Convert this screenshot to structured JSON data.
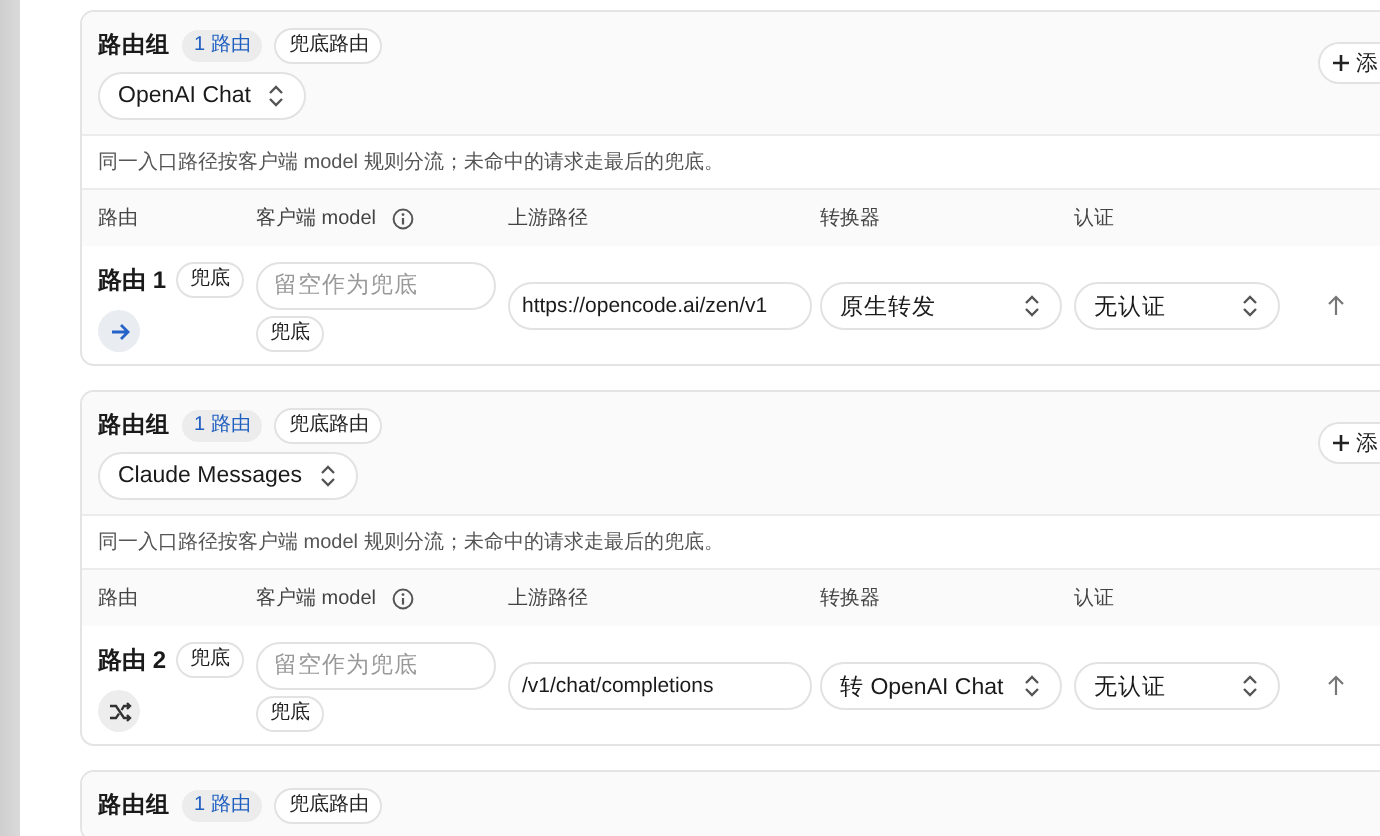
{
  "groups": [
    {
      "title": "路由组",
      "count_badge": "1 路由",
      "tag": "兜底路由",
      "protocol": "OpenAI Chat",
      "add_button": "添",
      "description": "同一入口路径按客户端 model 规则分流；未命中的请求走最后的兜底。",
      "columns": [
        "路由",
        "客户端 model",
        "上游路径",
        "转换器",
        "认证"
      ],
      "routes": [
        {
          "name": "路由 1",
          "tag": "兜底",
          "kind": "forward",
          "model_placeholder": "留空作为兜底",
          "model_tag": "兜底",
          "upstream": "https://opencode.ai/zen/v1",
          "converter": "原生转发",
          "auth": "无认证"
        }
      ]
    },
    {
      "title": "路由组",
      "count_badge": "1 路由",
      "tag": "兜底路由",
      "protocol": "Claude Messages",
      "add_button": "添",
      "description": "同一入口路径按客户端 model 规则分流；未命中的请求走最后的兜底。",
      "columns": [
        "路由",
        "客户端 model",
        "上游路径",
        "转换器",
        "认证"
      ],
      "routes": [
        {
          "name": "路由 2",
          "tag": "兜底",
          "kind": "shuffle",
          "model_placeholder": "留空作为兜底",
          "model_tag": "兜底",
          "upstream": "/v1/chat/completions",
          "converter": "转 OpenAI Chat",
          "auth": "无认证"
        }
      ]
    },
    {
      "title": "路由组",
      "count_badge": "1 路由",
      "tag": "兜底路由"
    }
  ]
}
